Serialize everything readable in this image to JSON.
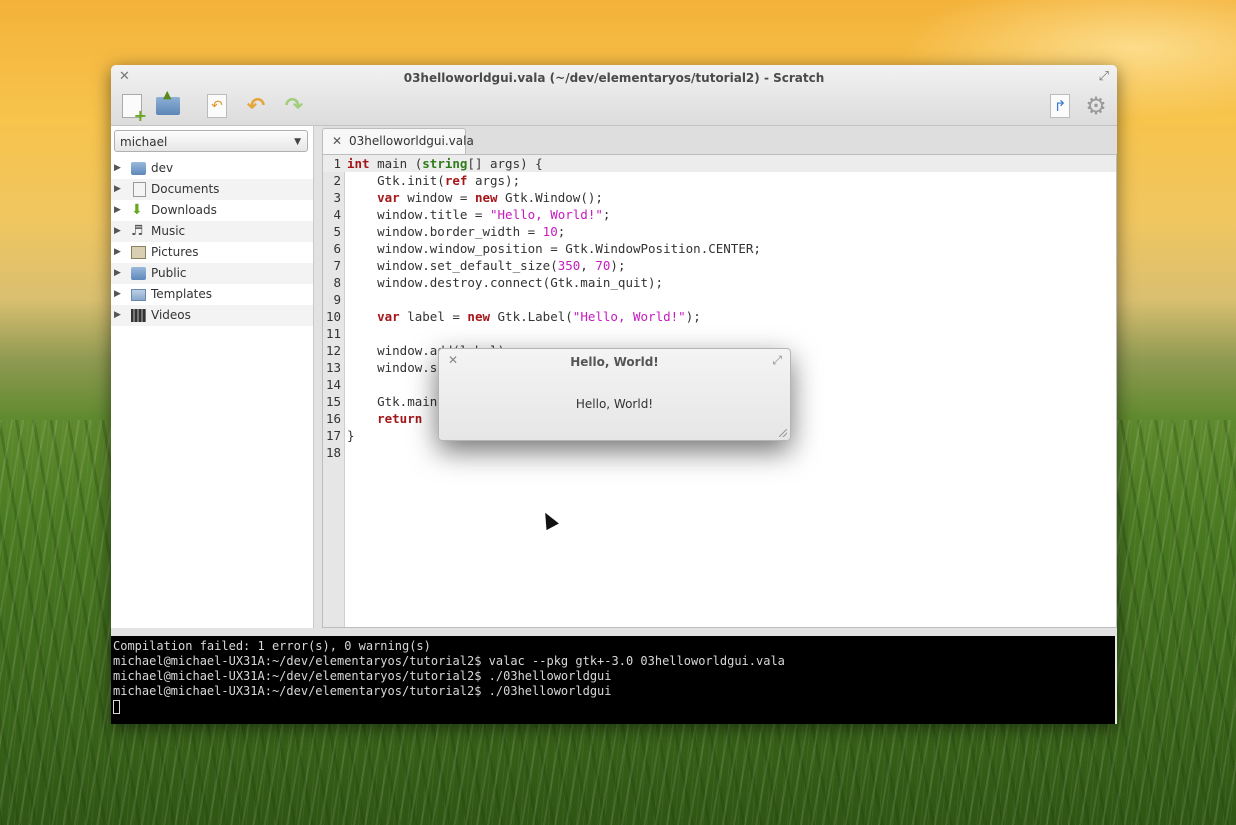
{
  "window": {
    "title": "03helloworldgui.vala (~/dev/elementaryos/tutorial2) - Scratch"
  },
  "toolbar": {
    "new_icon": "new-document-icon",
    "open_icon": "open-folder-icon",
    "revert_icon": "revert-icon",
    "undo_icon": "undo-icon",
    "redo_icon": "redo-icon",
    "share_icon": "share-icon",
    "settings_icon": "gear-icon"
  },
  "sidebar": {
    "folder_selector": "michael",
    "items": [
      {
        "label": "dev",
        "icon": "folder-icon"
      },
      {
        "label": "Documents",
        "icon": "documents-icon"
      },
      {
        "label": "Downloads",
        "icon": "downloads-icon"
      },
      {
        "label": "Music",
        "icon": "music-icon"
      },
      {
        "label": "Pictures",
        "icon": "pictures-icon"
      },
      {
        "label": "Public",
        "icon": "public-folder-icon"
      },
      {
        "label": "Templates",
        "icon": "templates-icon"
      },
      {
        "label": "Videos",
        "icon": "videos-icon"
      }
    ]
  },
  "editor": {
    "tab_label": "03helloworldgui.vala",
    "line_numbers": [
      "1",
      "2",
      "3",
      "4",
      "5",
      "6",
      "7",
      "8",
      "9",
      "10",
      "11",
      "12",
      "13",
      "14",
      "15",
      "16",
      "17",
      "18"
    ],
    "lines": [
      "int main (string[] args) {",
      "    Gtk.init(ref args);",
      "    var window = new Gtk.Window();",
      "    window.title = \"Hello, World!\";",
      "    window.border_width = 10;",
      "    window.window_position = Gtk.WindowPosition.CENTER;",
      "    window.set_default_size(350, 70);",
      "    window.destroy.connect(Gtk.main_quit);",
      "",
      "    var label = new Gtk.Label(\"Hello, World!\");",
      "",
      "    window.add(label);",
      "    window.s",
      "",
      "    Gtk.main",
      "    return",
      "}",
      ""
    ]
  },
  "terminal": {
    "lines": [
      "Compilation failed: 1 error(s), 0 warning(s)",
      "michael@michael-UX31A:~/dev/elementaryos/tutorial2$ valac --pkg gtk+-3.0 03helloworldgui.vala",
      "michael@michael-UX31A:~/dev/elementaryos/tutorial2$ ./03helloworldgui",
      "michael@michael-UX31A:~/dev/elementaryos/tutorial2$ ./03helloworldgui"
    ]
  },
  "dialog": {
    "title": "Hello, World!",
    "label": "Hello, World!"
  }
}
